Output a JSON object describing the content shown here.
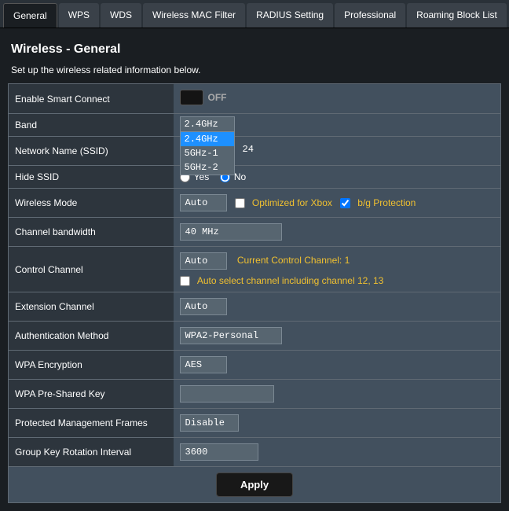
{
  "tabs": {
    "general": "General",
    "wps": "WPS",
    "wds": "WDS",
    "macfilter": "Wireless MAC Filter",
    "radius": "RADIUS Setting",
    "professional": "Professional",
    "roaming": "Roaming Block List"
  },
  "page": {
    "title": "Wireless - General",
    "desc": "Set up the wireless related information below."
  },
  "labels": {
    "smartconnect": "Enable Smart Connect",
    "band": "Band",
    "ssid": "Network Name (SSID)",
    "hidessid": "Hide SSID",
    "wmode": "Wireless Mode",
    "chbw": "Channel bandwidth",
    "cchannel": "Control Channel",
    "extch": "Extension Channel",
    "auth": "Authentication Method",
    "wpaenc": "WPA Encryption",
    "psk": "WPA Pre-Shared Key",
    "pmf": "Protected Management Frames",
    "gkri": "Group Key Rotation Interval"
  },
  "values": {
    "smartconnect_state": "OFF",
    "band_selected": "2.4GHz",
    "band_options": [
      "2.4GHz",
      "5GHz-1",
      "5GHz-2"
    ],
    "ssid_visible_suffix": "24",
    "hidessid_yes": "Yes",
    "hidessid_no": "No",
    "hidessid_selected": "no",
    "wmode": "Auto",
    "wmode_xbox": "Optimized for Xbox",
    "wmode_bg": "b/g Protection",
    "chbw": "40 MHz",
    "cchannel": "Auto",
    "cchannel_status": "Current Control Channel: 1",
    "cchannel_autoselect": "Auto select channel including channel 12, 13",
    "extch": "Auto",
    "auth": "WPA2-Personal",
    "wpaenc": "AES",
    "psk": "",
    "pmf": "Disable",
    "gkri": "3600"
  },
  "buttons": {
    "apply": "Apply"
  }
}
